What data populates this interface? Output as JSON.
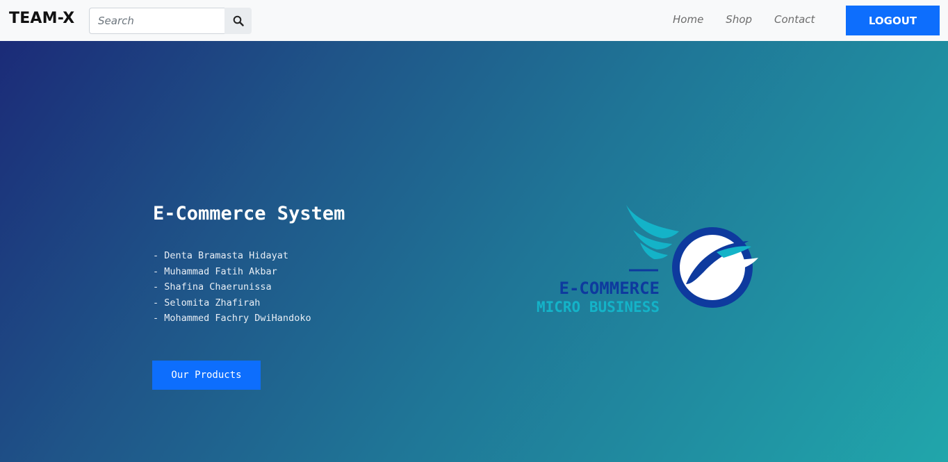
{
  "navbar": {
    "brand": "TEAM-X",
    "search": {
      "placeholder": "Search",
      "value": ""
    },
    "links": [
      {
        "label": "Home"
      },
      {
        "label": "Shop"
      },
      {
        "label": "Contact"
      }
    ],
    "logout_label": "LOGOUT"
  },
  "hero": {
    "title": "E-Commerce System",
    "members": [
      "- Denta Bramasta Hidayat",
      "- Muhammad Fatih Akbar",
      "- Shafina Chaerunissa",
      "- Selomita Zhafirah",
      "- Mohammed Fachry DwiHandoko"
    ],
    "cta_label": "Our Products",
    "logo": {
      "line1": "E-COMMERCE",
      "line2": "MICRO BUSINESS",
      "icon": "globe-wing-logo"
    }
  },
  "colors": {
    "primary": "#0d6efd",
    "navbar_bg": "#f8f9fa",
    "logo_dark_blue": "#0e3a9e",
    "logo_cyan": "#14b3c8"
  }
}
